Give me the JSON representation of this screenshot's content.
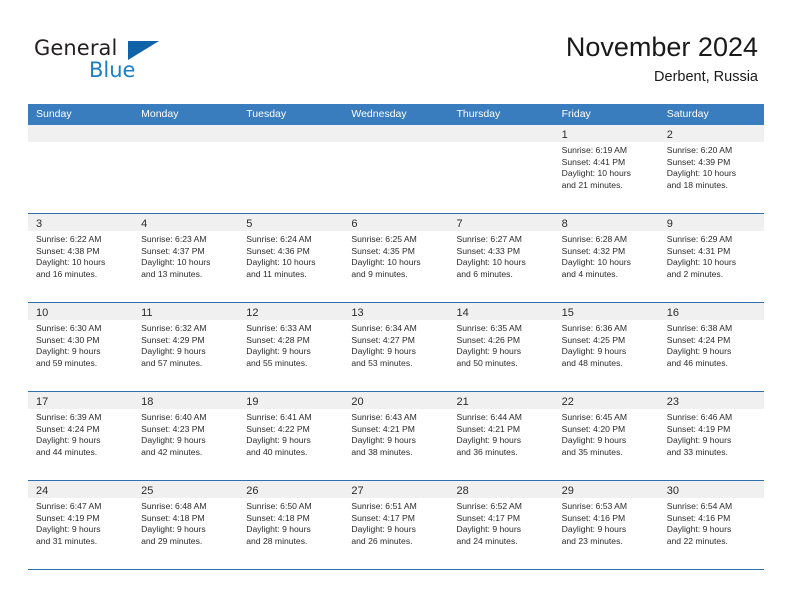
{
  "logo": {
    "text_primary": "General",
    "text_secondary": "Blue",
    "icon": "triangle-logo-icon"
  },
  "header": {
    "title": "November 2024",
    "location": "Derbent, Russia"
  },
  "calendar": {
    "weekdays": [
      "Sunday",
      "Monday",
      "Tuesday",
      "Wednesday",
      "Thursday",
      "Friday",
      "Saturday"
    ],
    "header_color": "#3a7dbf",
    "row_divider_color": "#2f6fae",
    "day_band_color": "#f0f0f0",
    "weeks": [
      [
        {
          "day": "",
          "lines": []
        },
        {
          "day": "",
          "lines": []
        },
        {
          "day": "",
          "lines": []
        },
        {
          "day": "",
          "lines": []
        },
        {
          "day": "",
          "lines": []
        },
        {
          "day": "1",
          "lines": [
            "Sunrise: 6:19 AM",
            "Sunset: 4:41 PM",
            "Daylight: 10 hours",
            "and 21 minutes."
          ]
        },
        {
          "day": "2",
          "lines": [
            "Sunrise: 6:20 AM",
            "Sunset: 4:39 PM",
            "Daylight: 10 hours",
            "and 18 minutes."
          ]
        }
      ],
      [
        {
          "day": "3",
          "lines": [
            "Sunrise: 6:22 AM",
            "Sunset: 4:38 PM",
            "Daylight: 10 hours",
            "and 16 minutes."
          ]
        },
        {
          "day": "4",
          "lines": [
            "Sunrise: 6:23 AM",
            "Sunset: 4:37 PM",
            "Daylight: 10 hours",
            "and 13 minutes."
          ]
        },
        {
          "day": "5",
          "lines": [
            "Sunrise: 6:24 AM",
            "Sunset: 4:36 PM",
            "Daylight: 10 hours",
            "and 11 minutes."
          ]
        },
        {
          "day": "6",
          "lines": [
            "Sunrise: 6:25 AM",
            "Sunset: 4:35 PM",
            "Daylight: 10 hours",
            "and 9 minutes."
          ]
        },
        {
          "day": "7",
          "lines": [
            "Sunrise: 6:27 AM",
            "Sunset: 4:33 PM",
            "Daylight: 10 hours",
            "and 6 minutes."
          ]
        },
        {
          "day": "8",
          "lines": [
            "Sunrise: 6:28 AM",
            "Sunset: 4:32 PM",
            "Daylight: 10 hours",
            "and 4 minutes."
          ]
        },
        {
          "day": "9",
          "lines": [
            "Sunrise: 6:29 AM",
            "Sunset: 4:31 PM",
            "Daylight: 10 hours",
            "and 2 minutes."
          ]
        }
      ],
      [
        {
          "day": "10",
          "lines": [
            "Sunrise: 6:30 AM",
            "Sunset: 4:30 PM",
            "Daylight: 9 hours",
            "and 59 minutes."
          ]
        },
        {
          "day": "11",
          "lines": [
            "Sunrise: 6:32 AM",
            "Sunset: 4:29 PM",
            "Daylight: 9 hours",
            "and 57 minutes."
          ]
        },
        {
          "day": "12",
          "lines": [
            "Sunrise: 6:33 AM",
            "Sunset: 4:28 PM",
            "Daylight: 9 hours",
            "and 55 minutes."
          ]
        },
        {
          "day": "13",
          "lines": [
            "Sunrise: 6:34 AM",
            "Sunset: 4:27 PM",
            "Daylight: 9 hours",
            "and 53 minutes."
          ]
        },
        {
          "day": "14",
          "lines": [
            "Sunrise: 6:35 AM",
            "Sunset: 4:26 PM",
            "Daylight: 9 hours",
            "and 50 minutes."
          ]
        },
        {
          "day": "15",
          "lines": [
            "Sunrise: 6:36 AM",
            "Sunset: 4:25 PM",
            "Daylight: 9 hours",
            "and 48 minutes."
          ]
        },
        {
          "day": "16",
          "lines": [
            "Sunrise: 6:38 AM",
            "Sunset: 4:24 PM",
            "Daylight: 9 hours",
            "and 46 minutes."
          ]
        }
      ],
      [
        {
          "day": "17",
          "lines": [
            "Sunrise: 6:39 AM",
            "Sunset: 4:24 PM",
            "Daylight: 9 hours",
            "and 44 minutes."
          ]
        },
        {
          "day": "18",
          "lines": [
            "Sunrise: 6:40 AM",
            "Sunset: 4:23 PM",
            "Daylight: 9 hours",
            "and 42 minutes."
          ]
        },
        {
          "day": "19",
          "lines": [
            "Sunrise: 6:41 AM",
            "Sunset: 4:22 PM",
            "Daylight: 9 hours",
            "and 40 minutes."
          ]
        },
        {
          "day": "20",
          "lines": [
            "Sunrise: 6:43 AM",
            "Sunset: 4:21 PM",
            "Daylight: 9 hours",
            "and 38 minutes."
          ]
        },
        {
          "day": "21",
          "lines": [
            "Sunrise: 6:44 AM",
            "Sunset: 4:21 PM",
            "Daylight: 9 hours",
            "and 36 minutes."
          ]
        },
        {
          "day": "22",
          "lines": [
            "Sunrise: 6:45 AM",
            "Sunset: 4:20 PM",
            "Daylight: 9 hours",
            "and 35 minutes."
          ]
        },
        {
          "day": "23",
          "lines": [
            "Sunrise: 6:46 AM",
            "Sunset: 4:19 PM",
            "Daylight: 9 hours",
            "and 33 minutes."
          ]
        }
      ],
      [
        {
          "day": "24",
          "lines": [
            "Sunrise: 6:47 AM",
            "Sunset: 4:19 PM",
            "Daylight: 9 hours",
            "and 31 minutes."
          ]
        },
        {
          "day": "25",
          "lines": [
            "Sunrise: 6:48 AM",
            "Sunset: 4:18 PM",
            "Daylight: 9 hours",
            "and 29 minutes."
          ]
        },
        {
          "day": "26",
          "lines": [
            "Sunrise: 6:50 AM",
            "Sunset: 4:18 PM",
            "Daylight: 9 hours",
            "and 28 minutes."
          ]
        },
        {
          "day": "27",
          "lines": [
            "Sunrise: 6:51 AM",
            "Sunset: 4:17 PM",
            "Daylight: 9 hours",
            "and 26 minutes."
          ]
        },
        {
          "day": "28",
          "lines": [
            "Sunrise: 6:52 AM",
            "Sunset: 4:17 PM",
            "Daylight: 9 hours",
            "and 24 minutes."
          ]
        },
        {
          "day": "29",
          "lines": [
            "Sunrise: 6:53 AM",
            "Sunset: 4:16 PM",
            "Daylight: 9 hours",
            "and 23 minutes."
          ]
        },
        {
          "day": "30",
          "lines": [
            "Sunrise: 6:54 AM",
            "Sunset: 4:16 PM",
            "Daylight: 9 hours",
            "and 22 minutes."
          ]
        }
      ]
    ]
  }
}
